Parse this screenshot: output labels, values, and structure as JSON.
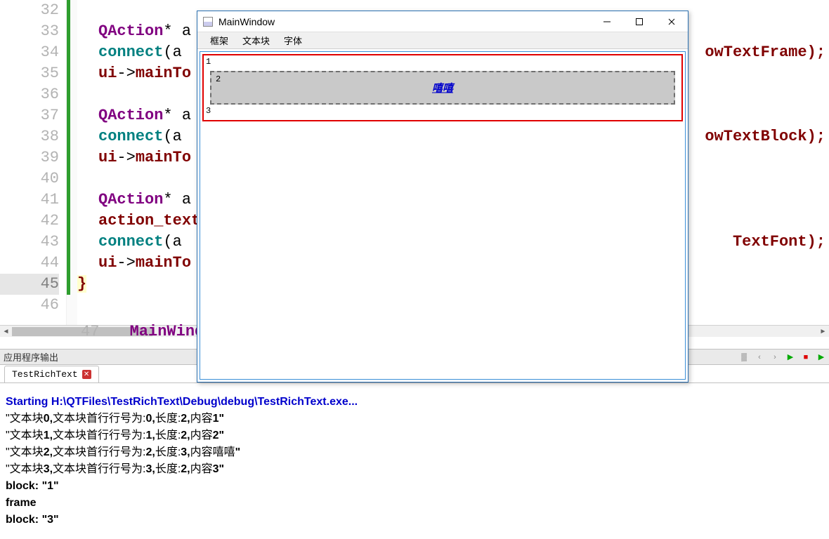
{
  "editor": {
    "lines": [
      32,
      33,
      34,
      35,
      36,
      37,
      38,
      39,
      40,
      41,
      42,
      43,
      44,
      45,
      46
    ],
    "current_line": 45,
    "code": {
      "l33_type": "QAction",
      "l33_ptr": "* a",
      "l34_func": "connect",
      "l34_arg": "(a",
      "l34_tail": "owTextFrame);",
      "l35_ui": "ui",
      "l35_arrow": "->",
      "l35_mainTo": "mainTo",
      "l37_type": "QAction",
      "l37_ptr": "* a",
      "l38_func": "connect",
      "l38_arg": "(a",
      "l38_tail": "owTextBlock);",
      "l39_ui": "ui",
      "l39_arrow": "->",
      "l39_mainTo": "mainTo",
      "l41_type": "QAction",
      "l41_ptr": "* a",
      "l42_at": "action_text",
      "l43_func": "connect",
      "l43_arg": "(a",
      "l43_tail": "TextFont);",
      "l44_ui": "ui",
      "l44_arrow": "->",
      "l44_mainTo": "mainTo",
      "l45_brace": "}",
      "l47_mw": "MainWindow"
    }
  },
  "output": {
    "panel_title": "应用程序输出",
    "tab_label": "TestRichText",
    "starting": "Starting H:\\QTFiles\\TestRichText\\Debug\\debug\\TestRichText.exe...",
    "lines": [
      {
        "pre": "\"文本块",
        "b1": "0,",
        "mid": "文本块首行行号为:",
        "b2": "0,",
        "mid2": "长度:",
        "b3": "2,",
        "mid3": "内容",
        "b4": "1\""
      },
      {
        "pre": "\"文本块",
        "b1": "1,",
        "mid": "文本块首行行号为:",
        "b2": "1,",
        "mid2": "长度:",
        "b3": "2,",
        "mid3": "内容",
        "b4": "2\""
      },
      {
        "pre": "\"文本块",
        "b1": "2,",
        "mid": "文本块首行行号为:",
        "b2": "2,",
        "mid2": "长度:",
        "b3": "3,",
        "mid3": "内容嘻嘻",
        "b4": "\""
      },
      {
        "pre": "\"文本块",
        "b1": "3,",
        "mid": "文本块首行行号为:",
        "b2": "3,",
        "mid2": "长度:",
        "b3": "2,",
        "mid3": "内容",
        "b4": "3\""
      }
    ],
    "block1": "block: \"1\"",
    "frame_line": "frame",
    "block3": "block: \"3\""
  },
  "appwin": {
    "title": "MainWindow",
    "menu": {
      "frame": "框架",
      "textblock": "文本块",
      "font": "字体"
    },
    "content": {
      "one": "1",
      "two": "2",
      "xixi": "嘻嘻",
      "three": "3"
    }
  }
}
